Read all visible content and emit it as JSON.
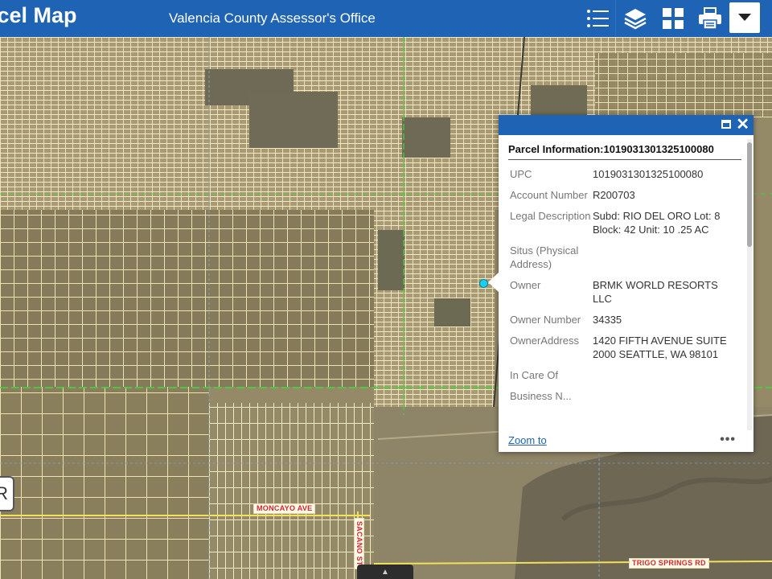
{
  "header": {
    "app_title": "rcel Map",
    "subtitle": "Valencia County Assessor's Office",
    "icons": [
      "list-icon",
      "layers-icon",
      "grid-icon",
      "print-icon",
      "caret-down-icon"
    ]
  },
  "map": {
    "road_labels": {
      "moncayo": "MONCAYO AVE",
      "trigo": "TRIGO SPRINGS RD",
      "sacano": "SACANO ST"
    },
    "left_tab_glyph": "R"
  },
  "popup": {
    "title": "Parcel Information:1019031301325100080",
    "attributes": [
      {
        "label": "UPC",
        "value": "1019031301325100080"
      },
      {
        "label": "Account Number",
        "value": "R200703"
      },
      {
        "label": "Legal Description",
        "value": "Subd: RIO DEL ORO Lot: 8 Block: 42 Unit: 10 .25 AC"
      },
      {
        "label": "Situs (Physical Address)",
        "value": ""
      },
      {
        "label": "Owner",
        "value": "BRMK WORLD RESORTS LLC"
      },
      {
        "label": "Owner Number",
        "value": "34335"
      },
      {
        "label": "OwnerAddress",
        "value": "1420 FIFTH AVENUE SUITE 2000 SEATTLE, WA 98101"
      },
      {
        "label": "In Care Of",
        "value": ""
      },
      {
        "label": "Business N...",
        "value": ""
      }
    ],
    "zoom_to": "Zoom to",
    "more": "•••"
  },
  "colors": {
    "header_blue": "#1f63b5",
    "parcel_line": "#f5e9c0",
    "section_line": "#3ee03a",
    "imagery": "#9a8e6e"
  }
}
